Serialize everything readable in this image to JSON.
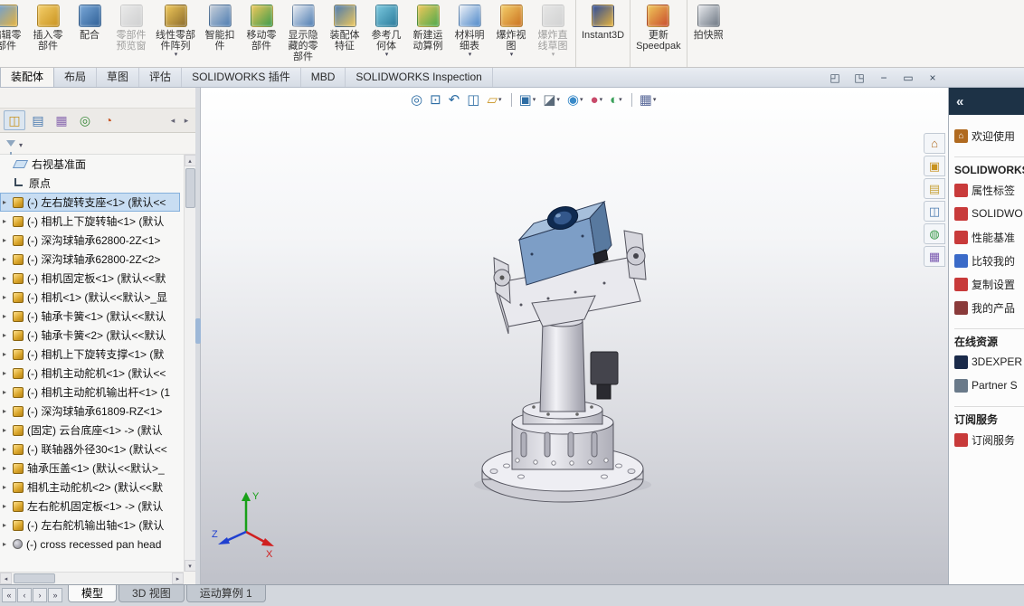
{
  "app": {
    "name": "SOLIDWORKS"
  },
  "ribbon": {
    "buttons": [
      {
        "name": "edit-component-button",
        "label1": "编辑零",
        "label2": "部件",
        "c1": "#6a9fd8",
        "c2": "#e8b33a"
      },
      {
        "name": "insert-component-button",
        "label1": "插入零",
        "label2": "部件",
        "c1": "#f4cf6a",
        "c2": "#c9921e"
      },
      {
        "name": "mate-button",
        "label1": "配合",
        "c1": "#7aa8d8",
        "c2": "#2e5f96"
      },
      {
        "name": "component-preview-button",
        "label1": "零部件",
        "label2": "预览窗",
        "c1": "#d8dce2",
        "c2": "#9aa4b0",
        "disabled": true
      },
      {
        "name": "linear-pattern-button",
        "label1": "线性零部",
        "label2": "件阵列",
        "c1": "#f0c85a",
        "c2": "#8a6a2a",
        "arrow": true
      },
      {
        "name": "smart-fasteners-button",
        "label1": "智能扣",
        "label2": "件",
        "c1": "#c8d0da",
        "c2": "#4a7ab0"
      },
      {
        "name": "move-component-button",
        "label1": "移动零",
        "label2": "部件",
        "c1": "#f0c85a",
        "c2": "#3a9a4a"
      },
      {
        "name": "show-hidden-button",
        "label1": "显示隐",
        "label2": "藏的零",
        "label3": "部件",
        "c1": "#e8ecf2",
        "c2": "#4a7ab0"
      },
      {
        "name": "assembly-features-button",
        "label1": "装配体",
        "label2": "特征",
        "c1": "#4a7ab0",
        "c2": "#f0c85a"
      },
      {
        "name": "reference-geometry-button",
        "label1": "参考几",
        "label2": "何体",
        "c1": "#7ac8de",
        "c2": "#2a7a9a",
        "arrow": true
      },
      {
        "name": "motion-study-button",
        "label1": "新建运",
        "label2": "动算例",
        "c1": "#f0c85a",
        "c2": "#4aa84a"
      },
      {
        "name": "bom-button",
        "label1": "材料明",
        "label2": "细表",
        "c1": "#eef2f8",
        "c2": "#4a86c8",
        "arrow": true
      },
      {
        "name": "exploded-view-button",
        "label1": "爆炸视",
        "label2": "图",
        "c1": "#f4cf6a",
        "c2": "#c9701e",
        "arrow": true
      },
      {
        "name": "explode-sketch-button",
        "label1": "爆炸直",
        "label2": "线草图",
        "c1": "#d0d4da",
        "c2": "#a0a8b2",
        "disabled": true,
        "arrow": true
      },
      {
        "name": "instant3d-button",
        "label1": "Instant3D",
        "c1": "#2a4a9a",
        "c2": "#e8b33a",
        "sep_before": true
      },
      {
        "name": "speedpak-button",
        "label1": "更新",
        "label2": "Speedpak",
        "c1": "#f0c85a",
        "c2": "#c84a2a",
        "sep_before": true
      },
      {
        "name": "snapshot-button",
        "label1": "拍快照",
        "c1": "#e8eaee",
        "c2": "#6a7480",
        "sep_before": true
      }
    ]
  },
  "command_tabs": {
    "items": [
      {
        "name": "tab-assembly",
        "label": "装配体",
        "active": true
      },
      {
        "name": "tab-layout",
        "label": "布局"
      },
      {
        "name": "tab-sketch",
        "label": "草图"
      },
      {
        "name": "tab-evaluate",
        "label": "评估"
      },
      {
        "name": "tab-solidworks-addins",
        "label": "SOLIDWORKS 插件"
      },
      {
        "name": "tab-mbd",
        "label": "MBD"
      },
      {
        "name": "tab-inspection",
        "label": "SOLIDWORKS Inspection"
      }
    ],
    "window_controls": [
      {
        "name": "dock-pane-left-icon",
        "glyph": "◰"
      },
      {
        "name": "dock-pane-right-icon",
        "glyph": "◳"
      },
      {
        "name": "minimize-icon",
        "glyph": "−"
      },
      {
        "name": "restore-icon",
        "glyph": "▭"
      },
      {
        "name": "close-icon",
        "glyph": "×"
      }
    ]
  },
  "feature_panel": {
    "scroll_left": "◂",
    "scroll_right": "▸",
    "tabs": [
      {
        "name": "featuremanager-tab",
        "glyph": "◫",
        "color": "#c8921e",
        "active": true
      },
      {
        "name": "propertymanager-tab",
        "glyph": "▤",
        "color": "#4a7ab0"
      },
      {
        "name": "configurationmanager-tab",
        "glyph": "▦",
        "color": "#8a6ab0"
      },
      {
        "name": "dimxpertmanager-tab",
        "glyph": "◎",
        "color": "#3a8a3a"
      },
      {
        "name": "displaymanager-tab",
        "glyph": "◔",
        "color": "#c85a2a"
      }
    ],
    "tree": [
      {
        "icon": "plane",
        "label": "右视基准面"
      },
      {
        "icon": "origin",
        "label": "原点"
      },
      {
        "icon": "part",
        "label": "(-) 左右旋转支座<1> (默认<<",
        "expander": true,
        "selected": true
      },
      {
        "icon": "part",
        "label": "(-) 相机上下旋转轴<1> (默认",
        "expander": true
      },
      {
        "icon": "part",
        "label": "(-) 深沟球轴承62800-2Z<1>",
        "expander": true
      },
      {
        "icon": "part",
        "label": "(-) 深沟球轴承62800-2Z<2>",
        "expander": true
      },
      {
        "icon": "part",
        "label": "(-) 相机固定板<1> (默认<<默",
        "expander": true
      },
      {
        "icon": "part",
        "label": "(-) 相机<1> (默认<<默认>_显",
        "expander": true
      },
      {
        "icon": "part",
        "label": "(-) 轴承卡簧<1> (默认<<默认",
        "expander": true
      },
      {
        "icon": "part",
        "label": "(-) 轴承卡簧<2> (默认<<默认",
        "expander": true
      },
      {
        "icon": "part",
        "label": "(-) 相机上下旋转支撑<1> (默",
        "expander": true
      },
      {
        "icon": "part",
        "label": "(-) 相机主动舵机<1> (默认<<",
        "expander": true
      },
      {
        "icon": "part",
        "label": "(-) 相机主动舵机输出杆<1> (1",
        "expander": true
      },
      {
        "icon": "part",
        "label": "(-) 深沟球轴承61809-RZ<1>",
        "expander": true
      },
      {
        "icon": "part",
        "label": "(固定) 云台底座<1> -> (默认",
        "expander": true
      },
      {
        "icon": "part",
        "label": "(-) 联轴器外径30<1> (默认<<",
        "expander": true
      },
      {
        "icon": "part",
        "label": "轴承压盖<1> (默认<<默认>_",
        "expander": true
      },
      {
        "icon": "part",
        "label": "相机主动舵机<2> (默认<<默",
        "expander": true
      },
      {
        "icon": "part",
        "label": "左右舵机固定板<1> -> (默认",
        "expander": true
      },
      {
        "icon": "part",
        "label": "(-) 左右舵机输出轴<1> (默认",
        "expander": true
      },
      {
        "icon": "screw",
        "label": "(-) cross recessed pan head",
        "expander": true
      }
    ]
  },
  "viewport": {
    "heads_up": [
      {
        "name": "zoom-fit-icon",
        "glyph": "◎",
        "color": "#2e6da4"
      },
      {
        "name": "zoom-area-icon",
        "glyph": "⊡",
        "color": "#2e6da4"
      },
      {
        "name": "previous-view-icon",
        "glyph": "↶",
        "color": "#2e6da4"
      },
      {
        "name": "section-view-icon",
        "glyph": "◫",
        "color": "#2e6da4"
      },
      {
        "name": "annotation-view-icon",
        "glyph": "▱",
        "color": "#c8921e",
        "arrow": true
      },
      {
        "name": "view-orientation-icon",
        "glyph": "▣",
        "color": "#2e6da4",
        "arrow": true,
        "sep_before": true
      },
      {
        "name": "display-style-icon",
        "glyph": "◪",
        "color": "#5a6a7a",
        "arrow": true
      },
      {
        "name": "hide-show-items-icon",
        "glyph": "◉",
        "color": "#3a8ac8",
        "arrow": true
      },
      {
        "name": "edit-appearance-icon",
        "glyph": "●",
        "color": "#c84a6a",
        "arrow": true
      },
      {
        "name": "apply-scene-icon",
        "glyph": "◐",
        "color": "#3aa05a",
        "arrow": true
      },
      {
        "name": "view-settings-icon",
        "glyph": "▦",
        "color": "#5a6a9a",
        "arrow": true,
        "sep_before": true
      }
    ],
    "triad": {
      "x_label": "X",
      "y_label": "Y",
      "z_label": "Z"
    }
  },
  "side_tabs": [
    {
      "name": "home-tab",
      "glyph": "⌂",
      "color": "#b06a20"
    },
    {
      "name": "design-library-tab",
      "glyph": "▣",
      "color": "#c8921e"
    },
    {
      "name": "file-explorer-tab",
      "glyph": "▤",
      "color": "#c8a23a"
    },
    {
      "name": "view-palette-tab",
      "glyph": "◫",
      "color": "#4a7ab0"
    },
    {
      "name": "appearances-scenes-tab",
      "glyph": "◍",
      "color": "#3a9a4a"
    },
    {
      "name": "custom-properties-tab",
      "glyph": "▦",
      "color": "#7a5ab0"
    }
  ],
  "task_pane": {
    "collapse_glyph": "«",
    "rows": [
      {
        "name": "welcome-link",
        "label": "欢迎使用",
        "glyph": "⌂",
        "icon_color": "#b06a20"
      },
      {
        "name": "section-header-solidworks",
        "label": "SOLIDWORKS",
        "header": true
      },
      {
        "name": "task-pane-item-property-tab",
        "label": "属性标签",
        "icon_color": "#c83a3a"
      },
      {
        "name": "task-pane-item-solidworks",
        "label": "SOLIDWO",
        "icon_color": "#c83a3a"
      },
      {
        "name": "task-pane-item-benchmark",
        "label": "性能基准",
        "icon_color": "#c83a3a"
      },
      {
        "name": "task-pane-item-compare",
        "label": "比较我的",
        "icon_color": "#3a6ac8"
      },
      {
        "name": "task-pane-item-copy-settings",
        "label": "复制设置",
        "icon_color": "#c83a3a"
      },
      {
        "name": "task-pane-item-my-products",
        "label": "我的产品",
        "icon_color": "#8a3a3a"
      },
      {
        "name": "section-header-online",
        "label": "在线资源",
        "header": true
      },
      {
        "name": "task-pane-item-3dexperience",
        "label": "3DEXPER",
        "icon_color": "#1a2a4a"
      },
      {
        "name": "task-pane-item-partner",
        "label": "Partner S",
        "icon_color": "#6a7a8a"
      },
      {
        "name": "section-header-subscription",
        "label": "订阅服务",
        "header": true
      },
      {
        "name": "task-pane-item-subscription",
        "label": "订阅服务",
        "icon_color": "#c83a3a"
      }
    ]
  },
  "status_bar": {
    "nav": [
      {
        "name": "scroll-first-icon",
        "glyph": "«"
      },
      {
        "name": "scroll-prev-icon",
        "glyph": "‹"
      },
      {
        "name": "scroll-next-icon",
        "glyph": "›"
      },
      {
        "name": "scroll-last-icon",
        "glyph": "»"
      }
    ],
    "tabs": [
      {
        "name": "model-tab",
        "label": "模型",
        "active": true
      },
      {
        "name": "3d-views-tab",
        "label": "3D 视图"
      },
      {
        "name": "motion-study-tab",
        "label": "运动算例 1"
      }
    ]
  }
}
